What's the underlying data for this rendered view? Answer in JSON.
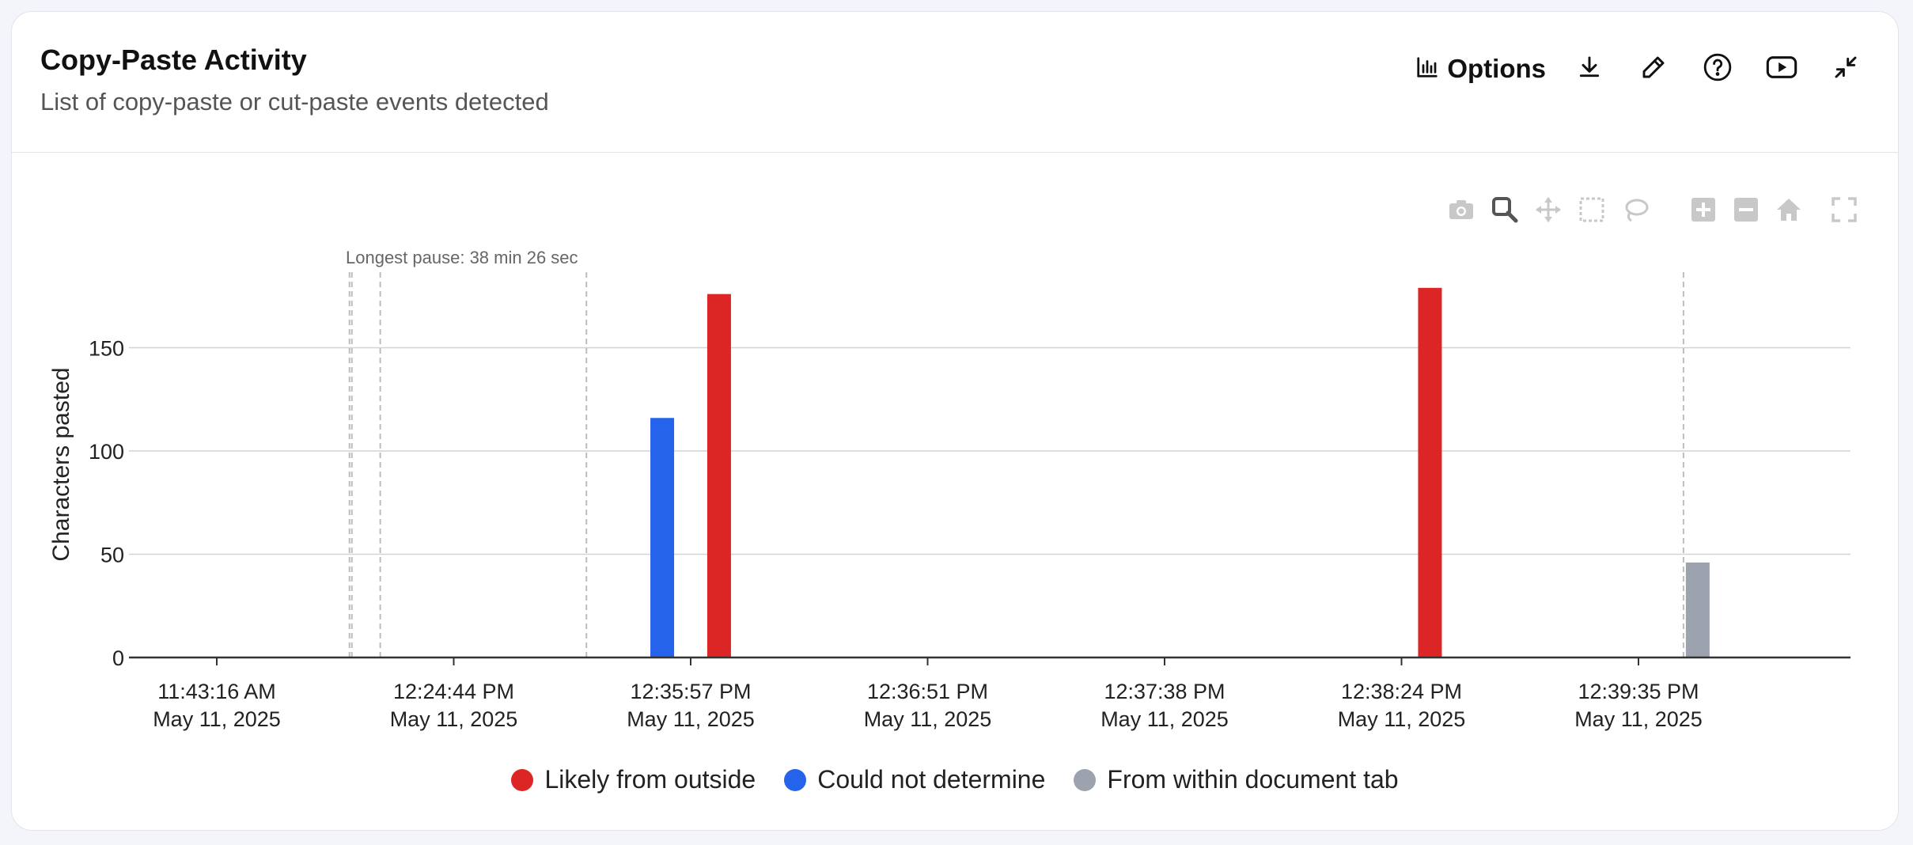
{
  "header": {
    "title": "Copy-Paste Activity",
    "subtitle": "List of copy-paste or cut-paste events detected",
    "options_label": "Options",
    "icons": [
      "bar-chart-icon",
      "download-icon",
      "edit-icon",
      "help-icon",
      "youtube-icon",
      "minimize-icon"
    ]
  },
  "modebar": {
    "icons": [
      "camera-icon",
      "zoom-icon",
      "pan-icon",
      "box-select-icon",
      "lasso-select-icon",
      "zoom-in-icon",
      "zoom-out-icon",
      "reset-axes-icon",
      "autoscale-icon"
    ],
    "active": "zoom-icon"
  },
  "chart_data": {
    "type": "bar",
    "ylabel": "Characters pasted",
    "ylim": [
      0,
      188
    ],
    "yticks": [
      0,
      50,
      100,
      150
    ],
    "grid": true,
    "xticks": [
      {
        "time": "11:43:16 AM",
        "date": "May 11, 2025"
      },
      {
        "time": "12:24:44 PM",
        "date": "May 11, 2025"
      },
      {
        "time": "12:35:57 PM",
        "date": "May 11, 2025"
      },
      {
        "time": "12:36:51 PM",
        "date": "May 11, 2025"
      },
      {
        "time": "12:37:38 PM",
        "date": "May 11, 2025"
      },
      {
        "time": "12:38:24 PM",
        "date": "May 11, 2025"
      },
      {
        "time": "12:39:35 PM",
        "date": "May 11, 2025"
      }
    ],
    "series": [
      {
        "name": "Likely from outside",
        "color": "#dc2626"
      },
      {
        "name": "Could not determine",
        "color": "#2563eb"
      },
      {
        "name": "From within document tab",
        "color": "#9ca3af"
      }
    ],
    "bars": [
      {
        "x": 2,
        "offset": -0.12,
        "value": 116,
        "series": 1
      },
      {
        "x": 2,
        "offset": 0.12,
        "value": 176,
        "series": 0
      },
      {
        "x": 5,
        "offset": 0.12,
        "value": 179,
        "series": 0
      },
      {
        "x": 6,
        "offset": 0.25,
        "value": 46,
        "series": 2
      }
    ],
    "pause_markers": [
      0.56,
      0.57,
      0.69,
      1.56,
      6.19
    ],
    "annotation": "Longest pause: 38 min 26 sec",
    "legend_position": "bottom-center"
  }
}
